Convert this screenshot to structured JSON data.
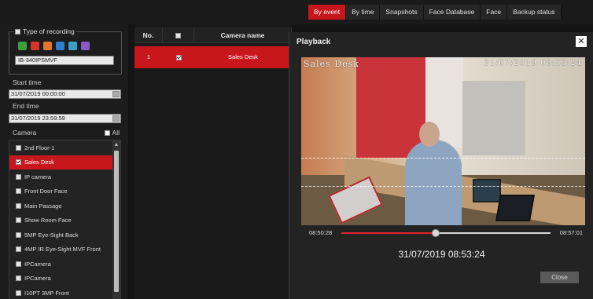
{
  "tabs": [
    {
      "label": "By event",
      "active": true
    },
    {
      "label": "By time",
      "active": false
    },
    {
      "label": "Snapshots",
      "active": false
    },
    {
      "label": "Face Database",
      "active": false
    },
    {
      "label": "Face",
      "active": false
    },
    {
      "label": "Backup status",
      "active": false
    }
  ],
  "sidebar": {
    "recording_type_label": "Type of recording",
    "recording_type_checked": false,
    "record_icons": [
      {
        "name": "general-record-icon",
        "color": "#3aa13a"
      },
      {
        "name": "alarm-record-icon",
        "color": "#d8352a"
      },
      {
        "name": "motion-record-icon",
        "color": "#e0782a"
      },
      {
        "name": "sensor-record-icon",
        "color": "#2f7fd0"
      },
      {
        "name": "smart-record-icon",
        "color": "#3aa0c8"
      },
      {
        "name": "face-record-icon",
        "color": "#8b58c8"
      }
    ],
    "device_value": "IB-340IPSMVF",
    "start_time_label": "Start time",
    "start_time_value": "31/07/2019 00:00:00",
    "end_time_label": "End time",
    "end_time_value": "31/07/2019 23:59:59",
    "camera_label": "Camera",
    "all_label": "All",
    "all_checked": false,
    "cameras": [
      {
        "label": "2nd Floor-1",
        "checked": false,
        "selected": false
      },
      {
        "label": "Sales Desk",
        "checked": true,
        "selected": true
      },
      {
        "label": "IP camera",
        "checked": false,
        "selected": false
      },
      {
        "label": "Front Door Face",
        "checked": false,
        "selected": false
      },
      {
        "label": "Main Passage",
        "checked": false,
        "selected": false
      },
      {
        "label": "Show Room Face",
        "checked": false,
        "selected": false
      },
      {
        "label": "5MP Eye-Sight Back",
        "checked": false,
        "selected": false
      },
      {
        "label": "4MP IR Eye-Sight MVF Front",
        "checked": false,
        "selected": false
      },
      {
        "label": "IPCamera",
        "checked": false,
        "selected": false
      },
      {
        "label": "IPCamera",
        "checked": false,
        "selected": false
      },
      {
        "label": "I10PT 3MP Front",
        "checked": false,
        "selected": false
      }
    ]
  },
  "table": {
    "col_no": "No.",
    "col_name": "Camera name",
    "rows": [
      {
        "no": "1",
        "checked": true,
        "name": "Sales Desk"
      }
    ]
  },
  "playback": {
    "title": "Playback",
    "video_overlay_name": "Sales Desk",
    "video_overlay_time": "31/07/2019 08:53:24",
    "timeline_start": "08:50:28",
    "timeline_end": "08:57:01",
    "progress_fraction": 0.45,
    "current_time": "31/07/2019 08:53:24",
    "close_button": "Close",
    "accent_color": "#e3232b"
  }
}
